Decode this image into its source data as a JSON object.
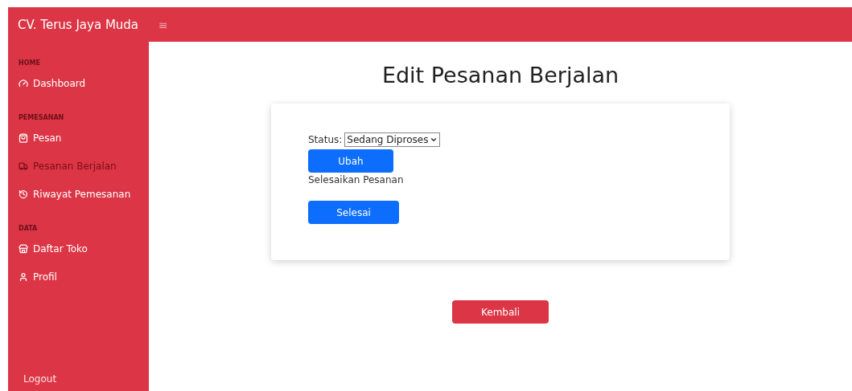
{
  "brand": "CV. Terus Jaya Muda",
  "menu_icon": "≡",
  "sidebar": {
    "sections": [
      {
        "heading": "HOME",
        "items": [
          {
            "label": "Dashboard",
            "selected": false
          }
        ]
      },
      {
        "heading": "PEMESANAN",
        "items": [
          {
            "label": "Pesan",
            "selected": false
          },
          {
            "label": "Pesanan Berjalan",
            "selected": true
          },
          {
            "label": "Riwayat Pemesanan",
            "selected": false
          }
        ]
      },
      {
        "heading": "DATA",
        "items": [
          {
            "label": "Daftar Toko",
            "selected": false
          },
          {
            "label": "Profil",
            "selected": false
          }
        ]
      }
    ],
    "logout": "Logout"
  },
  "page_title": "Edit Pesanan Berjalan",
  "form": {
    "status_label": "Status:",
    "status_value": "Sedang Diproses",
    "update_button": "Ubah",
    "finish_label": "Selesaikan Pesanan",
    "finish_button": "Selesai"
  },
  "back_button": "Kembali"
}
